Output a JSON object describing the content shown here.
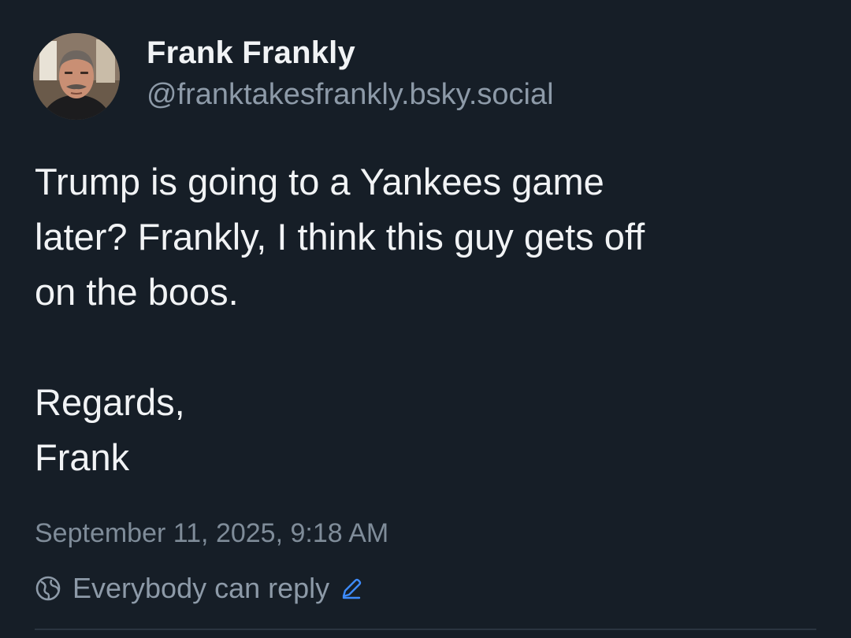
{
  "author": {
    "display_name": "Frank Frankly",
    "handle": "@franktakesfrankly.bsky.social"
  },
  "post": {
    "text": "Trump is going to a Yankees game\nlater? Frankly, I think this guy gets off\non the boos.\n\nRegards,\nFrank",
    "timestamp": "September 11, 2025, 9:18 AM"
  },
  "reply_settings": {
    "label": "Everybody can reply",
    "globe_icon": "globe-icon",
    "edit_icon": "pencil-icon",
    "accent_color": "#3d8bfd"
  },
  "colors": {
    "background": "#161e27",
    "text": "#f1f3f5",
    "muted": "#8d9aa8"
  }
}
